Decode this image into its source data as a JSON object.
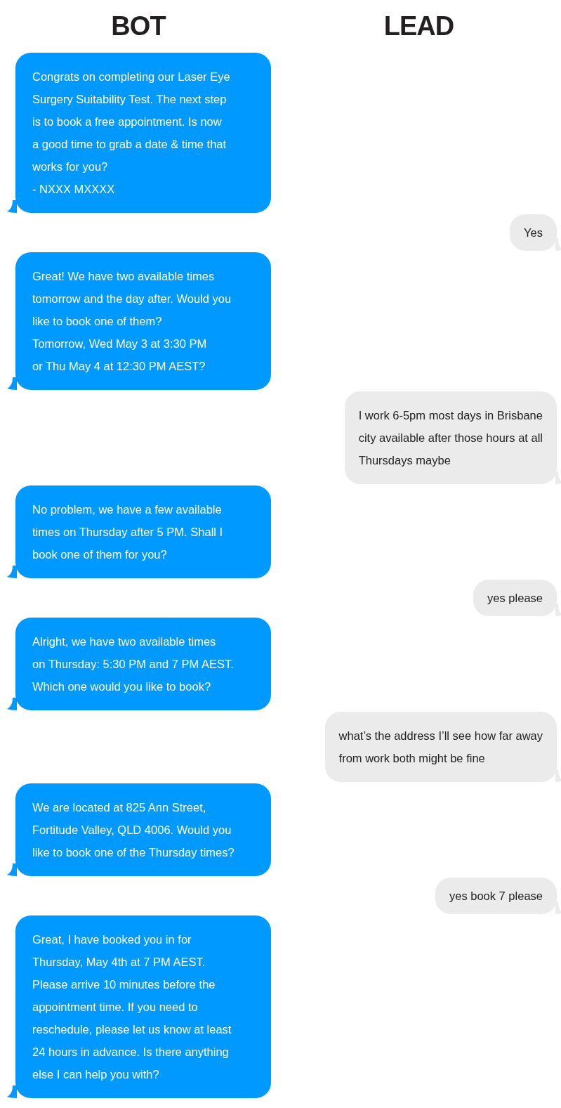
{
  "columns": [
    "BOT",
    "LEAD"
  ],
  "messages": [
    {
      "kind": "bot",
      "text": "Congrats on completing our Laser Eye\nSurgery Suitability Test. The next step\nis to book a free appointment. Is now\na good time to grab a date & time that\nworks for you?\n- NXXX MXXXX"
    },
    {
      "kind": "lead",
      "text": "Yes"
    },
    {
      "kind": "bot",
      "text": "Great! We have two available times\ntomorrow and the day after. Would you\nlike to book one of them?\nTomorrow, Wed May 3 at 3:30 PM\nor Thu May 4 at 12:30 PM AEST?"
    },
    {
      "kind": "lead",
      "text": "I work 6-5pm most days in Brisbane\ncity available after those hours at all\nThursdays maybe"
    },
    {
      "kind": "bot",
      "text": "No problem, we have a few available\ntimes on Thursday after 5 PM. Shall I\nbook one of them for you?"
    },
    {
      "kind": "lead",
      "text": "yes please"
    },
    {
      "kind": "bot",
      "text": "Alright, we have two available times\non Thursday: 5:30 PM and 7 PM AEST.\nWhich one would you like to book?"
    },
    {
      "kind": "lead",
      "text": "what’s the address I’ll see how far away\nfrom work both might be fine"
    },
    {
      "kind": "bot",
      "text": "We are located at 825 Ann Street,\nFortitude Valley, QLD 4006. Would you\nlike to book one of the Thursday times?"
    },
    {
      "kind": "lead",
      "text": "yes book 7 please"
    },
    {
      "kind": "bot",
      "text": "Great, I have booked you in for\nThursday, May 4th at 7 PM AEST.\nPlease arrive 10 minutes before the\nappointment time. If you need to\nreschedule, please let us know at least\n24 hours in advance. Is there anything\nelse I can help you with?"
    }
  ]
}
